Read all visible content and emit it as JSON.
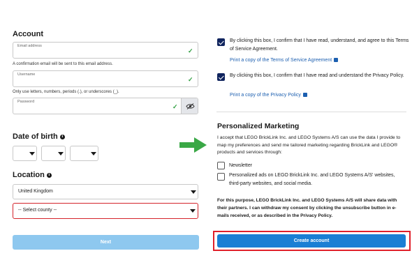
{
  "account": {
    "heading": "Account",
    "email_label": "Email address",
    "email_help": "A confirmation email will be sent to this email address.",
    "username_label": "Username",
    "username_help": "Only use letters, numbers, periods (.), or underscores (_).",
    "password_label": "Password"
  },
  "dob": {
    "heading": "Date of birth"
  },
  "location": {
    "heading": "Location",
    "country_value": "United Kingdom",
    "county_value": "-- Select county --"
  },
  "next_button": "Next",
  "terms": {
    "tos_text": "By clicking this box, I confirm that I have read, understand, and agree to this Terms of Service Agreement.",
    "tos_link": "Print a copy of the Terms of Service Agreement",
    "privacy_text": "By clicking this box, I confirm that I have read and understand the Privacy Policy.",
    "privacy_link": "Print a copy of the Privacy Policy"
  },
  "marketing": {
    "heading": "Personalized Marketing",
    "intro": "I accept that LEGO BrickLink Inc. and LEGO Systems A/S can use the data I provide to map my preferences and send me tailored marketing regarding BrickLink and LEGO® products and services through:",
    "option_newsletter": "Newsletter",
    "option_ads": "Personalized ads on LEGO BrickLink Inc. and LEGO Systems A/S' websites, third-party websites, and social media.",
    "disclaimer": "For this purpose, LEGO BrickLink Inc. and LEGO Systems A/S will share data with their partners. I can withdraw my consent by clicking the unsubscribe button in e-mails received, or as described in the Privacy Policy."
  },
  "create_account_button": "Create account",
  "colors": {
    "accent_blue": "#1a7fd4",
    "disabled_blue": "#8ec8ef",
    "checkbox_navy": "#10245e",
    "valid_green": "#2e9e3f",
    "highlight_red": "#e0202a",
    "arrow_green": "#3aa846"
  },
  "icons": [
    "check-icon",
    "eye-off-icon",
    "info-icon",
    "chevron-down-icon",
    "external-link-icon",
    "arrow-right-icon"
  ]
}
